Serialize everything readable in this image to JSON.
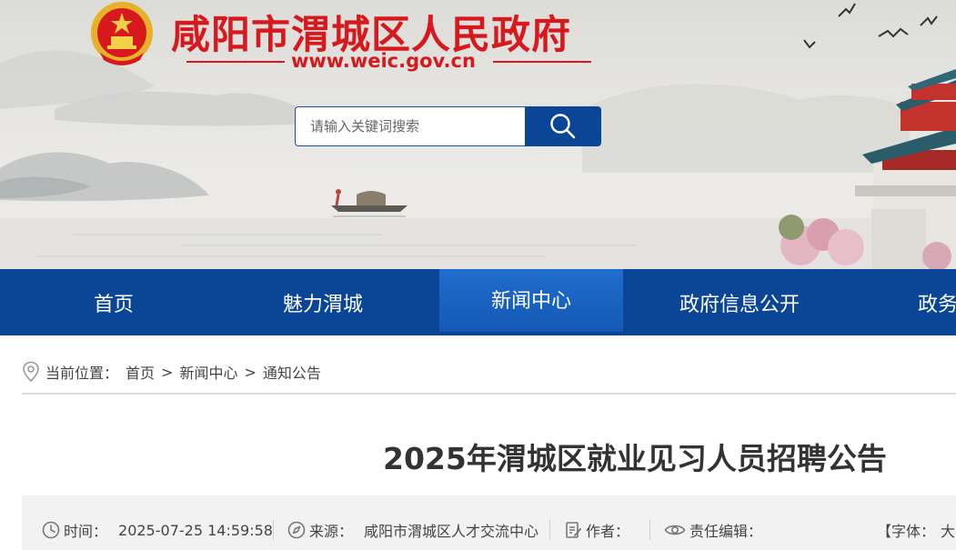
{
  "header": {
    "site_title": "咸阳市渭城区人民政府",
    "site_url": "www.weic.gov.cn",
    "brand_red": "#d7191e",
    "brand_blue": "#0b4596"
  },
  "search": {
    "placeholder": "请输入关键词搜索",
    "button_icon": "search-icon"
  },
  "nav": {
    "items": [
      {
        "label": "首页"
      },
      {
        "label": "魅力渭城"
      },
      {
        "label": "新闻中心"
      },
      {
        "label": "政府信息公开"
      },
      {
        "label": "政务服"
      }
    ],
    "active_index": 2
  },
  "breadcrumb": {
    "prefix": "当前位置：",
    "items": [
      "首页",
      "新闻中心",
      "通知公告"
    ],
    "separator": ">"
  },
  "article": {
    "title": "2025年渭城区就业见习人员招聘公告",
    "meta": {
      "time_label": "时间：",
      "time_value": "2025-07-25 14:59:58",
      "source_label": "来源：",
      "source_value": "咸阳市渭城区人才交流中心",
      "author_label": "作者：",
      "editor_label": "责任编辑：",
      "font_label": "【字体：",
      "font_size_option": "大"
    }
  }
}
